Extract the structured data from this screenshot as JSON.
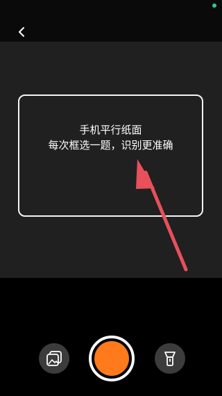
{
  "colors": {
    "status_dot": "#2ecc8b",
    "shutter": "#ff7a1a",
    "arrow": "#e8505b"
  },
  "hint": {
    "line1": "手机平行纸面",
    "line2": "每次框选一题，识别更准确"
  },
  "icons": {
    "back": "chevron-left-icon",
    "album": "album-icon",
    "flash": "flashlight-icon"
  }
}
